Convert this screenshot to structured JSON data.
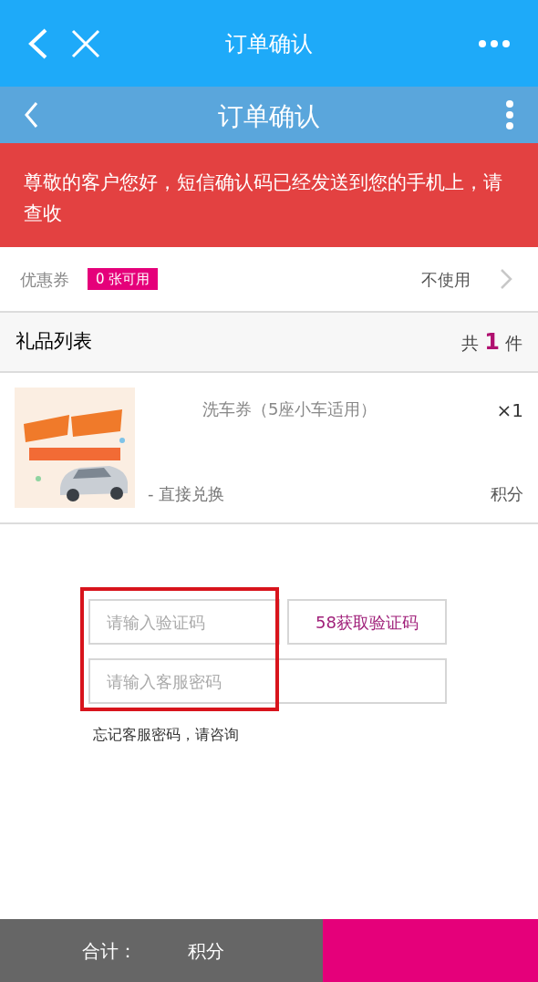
{
  "top_bar": {
    "title": "订单确认"
  },
  "page_header": {
    "title": "订单确认"
  },
  "notice": "尊敬的客户您好，短信确认码已经发送到您的手机上，请查收",
  "coupon": {
    "label": "优惠券",
    "badge": "0 张可用",
    "value": "不使用"
  },
  "gift_list": {
    "title": "礼品列表",
    "count_prefix": "共",
    "count": "1",
    "count_suffix": "件",
    "items": [
      {
        "kind": "picture",
        "name": "洗车券（5座小车适用）",
        "quantity": "×1",
        "method": "- 直接兑换",
        "points": "积分"
      }
    ]
  },
  "form": {
    "code_field": {
      "placeholder": "请输入验证码"
    },
    "code_button": "58获取验证码",
    "password_field": {
      "placeholder": "请输入客服密码"
    },
    "hint": "忘记客服密码，请咨询"
  },
  "footer": {
    "total_label": "合计：",
    "total_value": "积分"
  }
}
